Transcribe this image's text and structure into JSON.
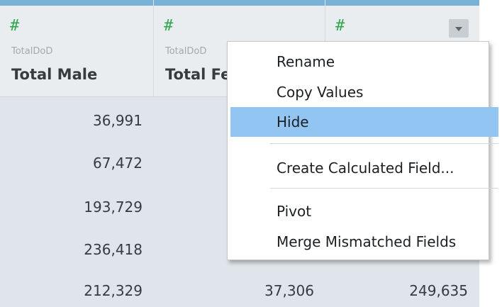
{
  "columns": [
    {
      "origin": "TotalDoD",
      "title": "Total Male"
    },
    {
      "origin": "TotalDoD",
      "title": "Total Fe"
    },
    {
      "origin": "",
      "title": ""
    }
  ],
  "rows": [
    [
      "36,991",
      "",
      ""
    ],
    [
      "67,472",
      "",
      ""
    ],
    [
      "193,729",
      "",
      ""
    ],
    [
      "236,418",
      "",
      ""
    ],
    [
      "212,329",
      "37,306",
      "249,635"
    ]
  ],
  "menu": {
    "items": [
      {
        "label": "Rename"
      },
      {
        "label": "Copy Values"
      },
      {
        "label": "Hide"
      },
      {
        "label": "Create Calculated Field..."
      },
      {
        "label": "Pivot"
      },
      {
        "label": "Merge Mismatched Fields"
      }
    ],
    "selected": "Hide"
  },
  "icons": {
    "field_type": "number-hash-icon",
    "dropdown": "chevron-down-icon"
  },
  "colors": {
    "field_type_icon": "#2fa54e",
    "header_accent": "#7ab1d6",
    "menu_selected": "#92c5f1"
  }
}
